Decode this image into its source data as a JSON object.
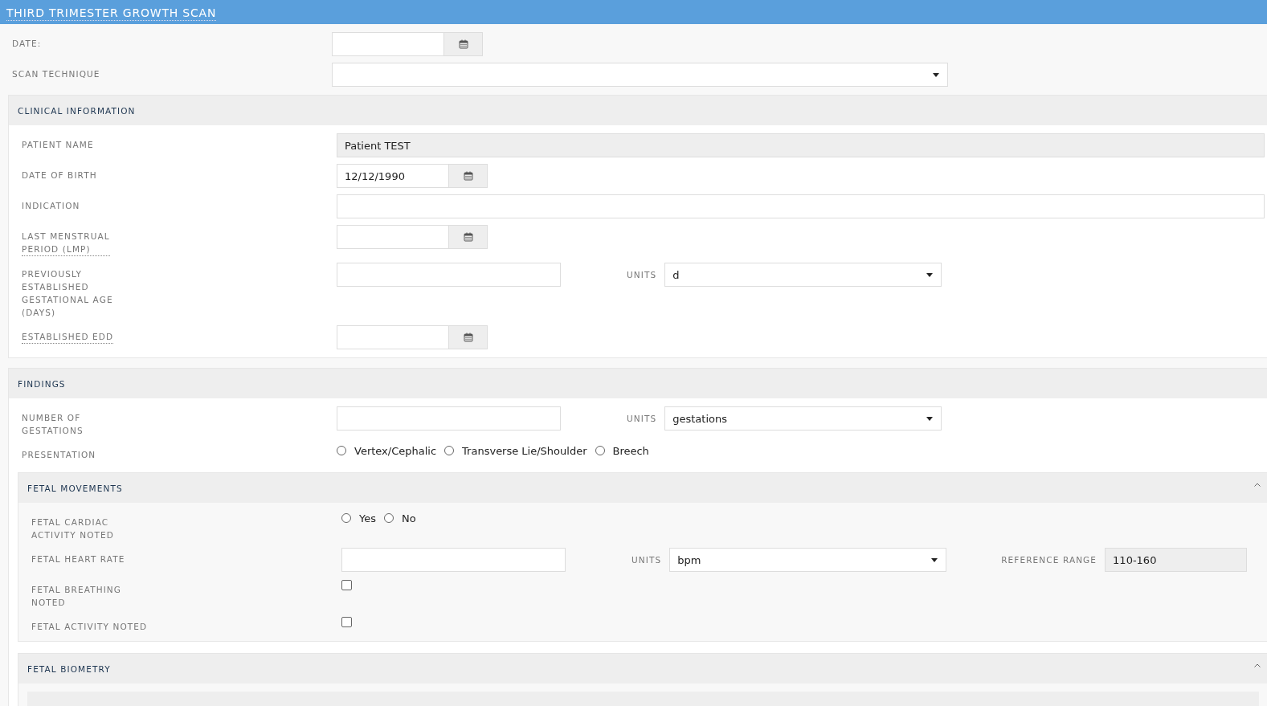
{
  "header": {
    "title": "THIRD TRIMESTER GROWTH SCAN"
  },
  "fields": [
    {
      "kind": "date",
      "label": "DATE:",
      "tooltip": false
    },
    {
      "kind": "select",
      "label": "SCAN TECHNIQUE",
      "tooltip": false
    }
  ],
  "sections": [
    {
      "title": "CLINICAL INFORMATION",
      "fields": [
        {
          "kind": "readonly",
          "label": "PATIENT NAME",
          "tooltip": false,
          "value": "Patient TEST"
        },
        {
          "kind": "date",
          "label": "DATE OF BIRTH",
          "tooltip": false,
          "value": "12/12/1990"
        },
        {
          "kind": "text",
          "label": "INDICATION",
          "tooltip": false
        },
        {
          "kind": "date",
          "label": "LAST MENSTRUAL\nPERIOD (LMP)",
          "tooltip": true
        },
        {
          "kind": "number",
          "label": "PREVIOUSLY\nESTABLISHED\nGESTATIONAL AGE\n(DAYS)",
          "tooltip": false,
          "units": {
            "label": "UNITS",
            "value": "d"
          }
        },
        {
          "kind": "date",
          "label": "ESTABLISHED EDD",
          "tooltip": true
        }
      ]
    },
    {
      "title": "FINDINGS",
      "fields": [
        {
          "kind": "number",
          "label": "NUMBER OF\nGESTATIONS",
          "tooltip": false,
          "units": {
            "label": "UNITS",
            "value": "gestations"
          }
        },
        {
          "kind": "radio",
          "label": "PRESENTATION",
          "tooltip": false,
          "options": [
            {
              "label": "Vertex/Cephalic",
              "selected": false
            },
            {
              "label": "Transverse Lie/Shoulder",
              "selected": false
            },
            {
              "label": "Breech",
              "selected": false
            }
          ]
        }
      ],
      "subsections": [
        {
          "title": "FETAL MOVEMENTS",
          "expanded": true,
          "fields": [
            {
              "kind": "radio",
              "label": "FETAL CARDIAC\nACTIVITY NOTED",
              "tooltip": false,
              "options": [
                {
                  "label": "Yes",
                  "selected": false
                },
                {
                  "label": "No",
                  "selected": false
                }
              ]
            },
            {
              "kind": "number",
              "label": "FETAL HEART RATE",
              "tooltip": false,
              "units": {
                "label": "UNITS",
                "value": "bpm"
              },
              "reference": {
                "label": "REFERENCE RANGE",
                "value": "110-160"
              }
            },
            {
              "kind": "checkbox",
              "label": "FETAL BREATHING\nNOTED",
              "tooltip": false,
              "checked": false
            },
            {
              "kind": "checkbox",
              "label": "FETAL ACTIVITY NOTED",
              "tooltip": false,
              "checked": false
            }
          ]
        },
        {
          "title": "FETAL BIOMETRY",
          "expanded": true
        }
      ]
    }
  ]
}
